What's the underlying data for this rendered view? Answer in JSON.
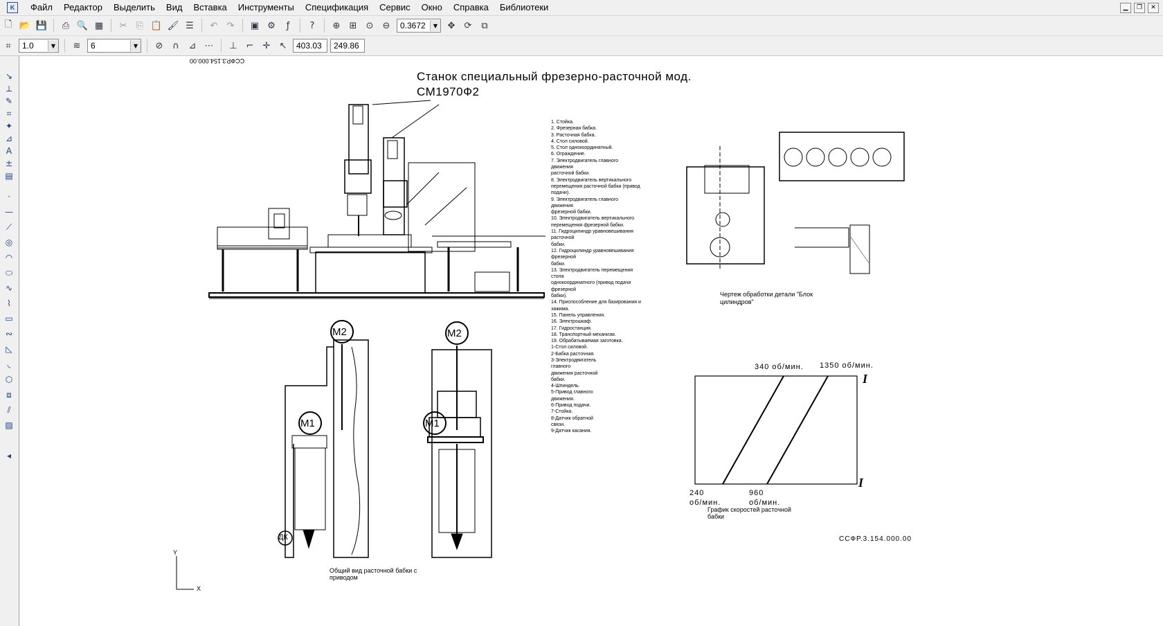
{
  "menu": [
    "Файл",
    "Редактор",
    "Выделить",
    "Вид",
    "Вставка",
    "Инструменты",
    "Спецификация",
    "Сервис",
    "Окно",
    "Справка",
    "Библиотеки"
  ],
  "toolbar": {
    "zoom_value": "0.3672",
    "step_value": "1.0",
    "layer_value": "6",
    "coord_x": "403.03",
    "coord_y": "249.86"
  },
  "drawing": {
    "top_stamp": "ССФР.3.154.000.00",
    "title_line1": "Станок специальный фрезерно-расточной мод.",
    "title_line2": "СМ1970Ф2",
    "parts_legend": [
      "1. Стойка.",
      "2. Фрезерная бабка.",
      "3. Расточная бабка.",
      "4. Стол силовой.",
      "5. Стол однокоординатный.",
      "6. Ограждение.",
      "7. Электродвигатель главного",
      "движения",
      "расточной бабки.",
      "8. Электродвигатель вертикального",
      "перемещения расточной бабки (привод",
      "подачи).",
      "9. Электродвигатель главного",
      "движения",
      "фрезерной бабки.",
      "10. Электродвигатель вертикального",
      "перемещения фрезерной бабки.",
      "11. Гидроцилиндр уравновешивания",
      "расточной",
      "бабки.",
      "12. Гидроцилиндр уравновешивания",
      "фрезерной",
      "бабки.",
      "13. Электродвигатель перемещения",
      "стола",
      "однокоординатного (привод подачи",
      "фрезерной",
      "бабки).",
      "14. Приспособление для базирования и",
      "зажима.",
      "15. Панель управления.",
      "16. Электрошкаф.",
      "17. Гидростанция.",
      "18. Транспортный механизм.",
      "19. Обрабатываемая заготовка.",
      "1-Стол силовой.",
      "2-Бабка расточная.",
      "3-Электродвигатель",
      "главного",
      "движения расточной",
      "бабки.",
      "4-Шпиндель.",
      "5-Привод главного",
      "движения.",
      "6-Привод подачи.",
      "7-Стойка.",
      "8-Датчик обратной",
      "связи.",
      "9-Датчик касания."
    ],
    "detail_caption_1": "Чертеж обработки детали \"Блок",
    "detail_caption_2": "цилиндров\"",
    "speed_chart": {
      "label_340": "340 об/мин.",
      "label_1350": "1350 об/мин.",
      "label_240": "240",
      "label_240_unit": "об/мин.",
      "label_960": "960",
      "label_960_unit": "об/мин.",
      "roman_top": "I",
      "roman_bottom": "I",
      "caption_1": "График скоростей расточной",
      "caption_2": "бабки"
    },
    "general_view_caption_1": "Общий вид расточной бабки с",
    "general_view_caption_2": "приводом",
    "bottom_stamp": "ССФР.3.154.000.00",
    "m2_left": "M2",
    "m1_left": "M1",
    "m2_right": "M2",
    "m1_right": "M1",
    "dk_label": "ДК",
    "axis_y": "Y",
    "axis_x": "X"
  }
}
